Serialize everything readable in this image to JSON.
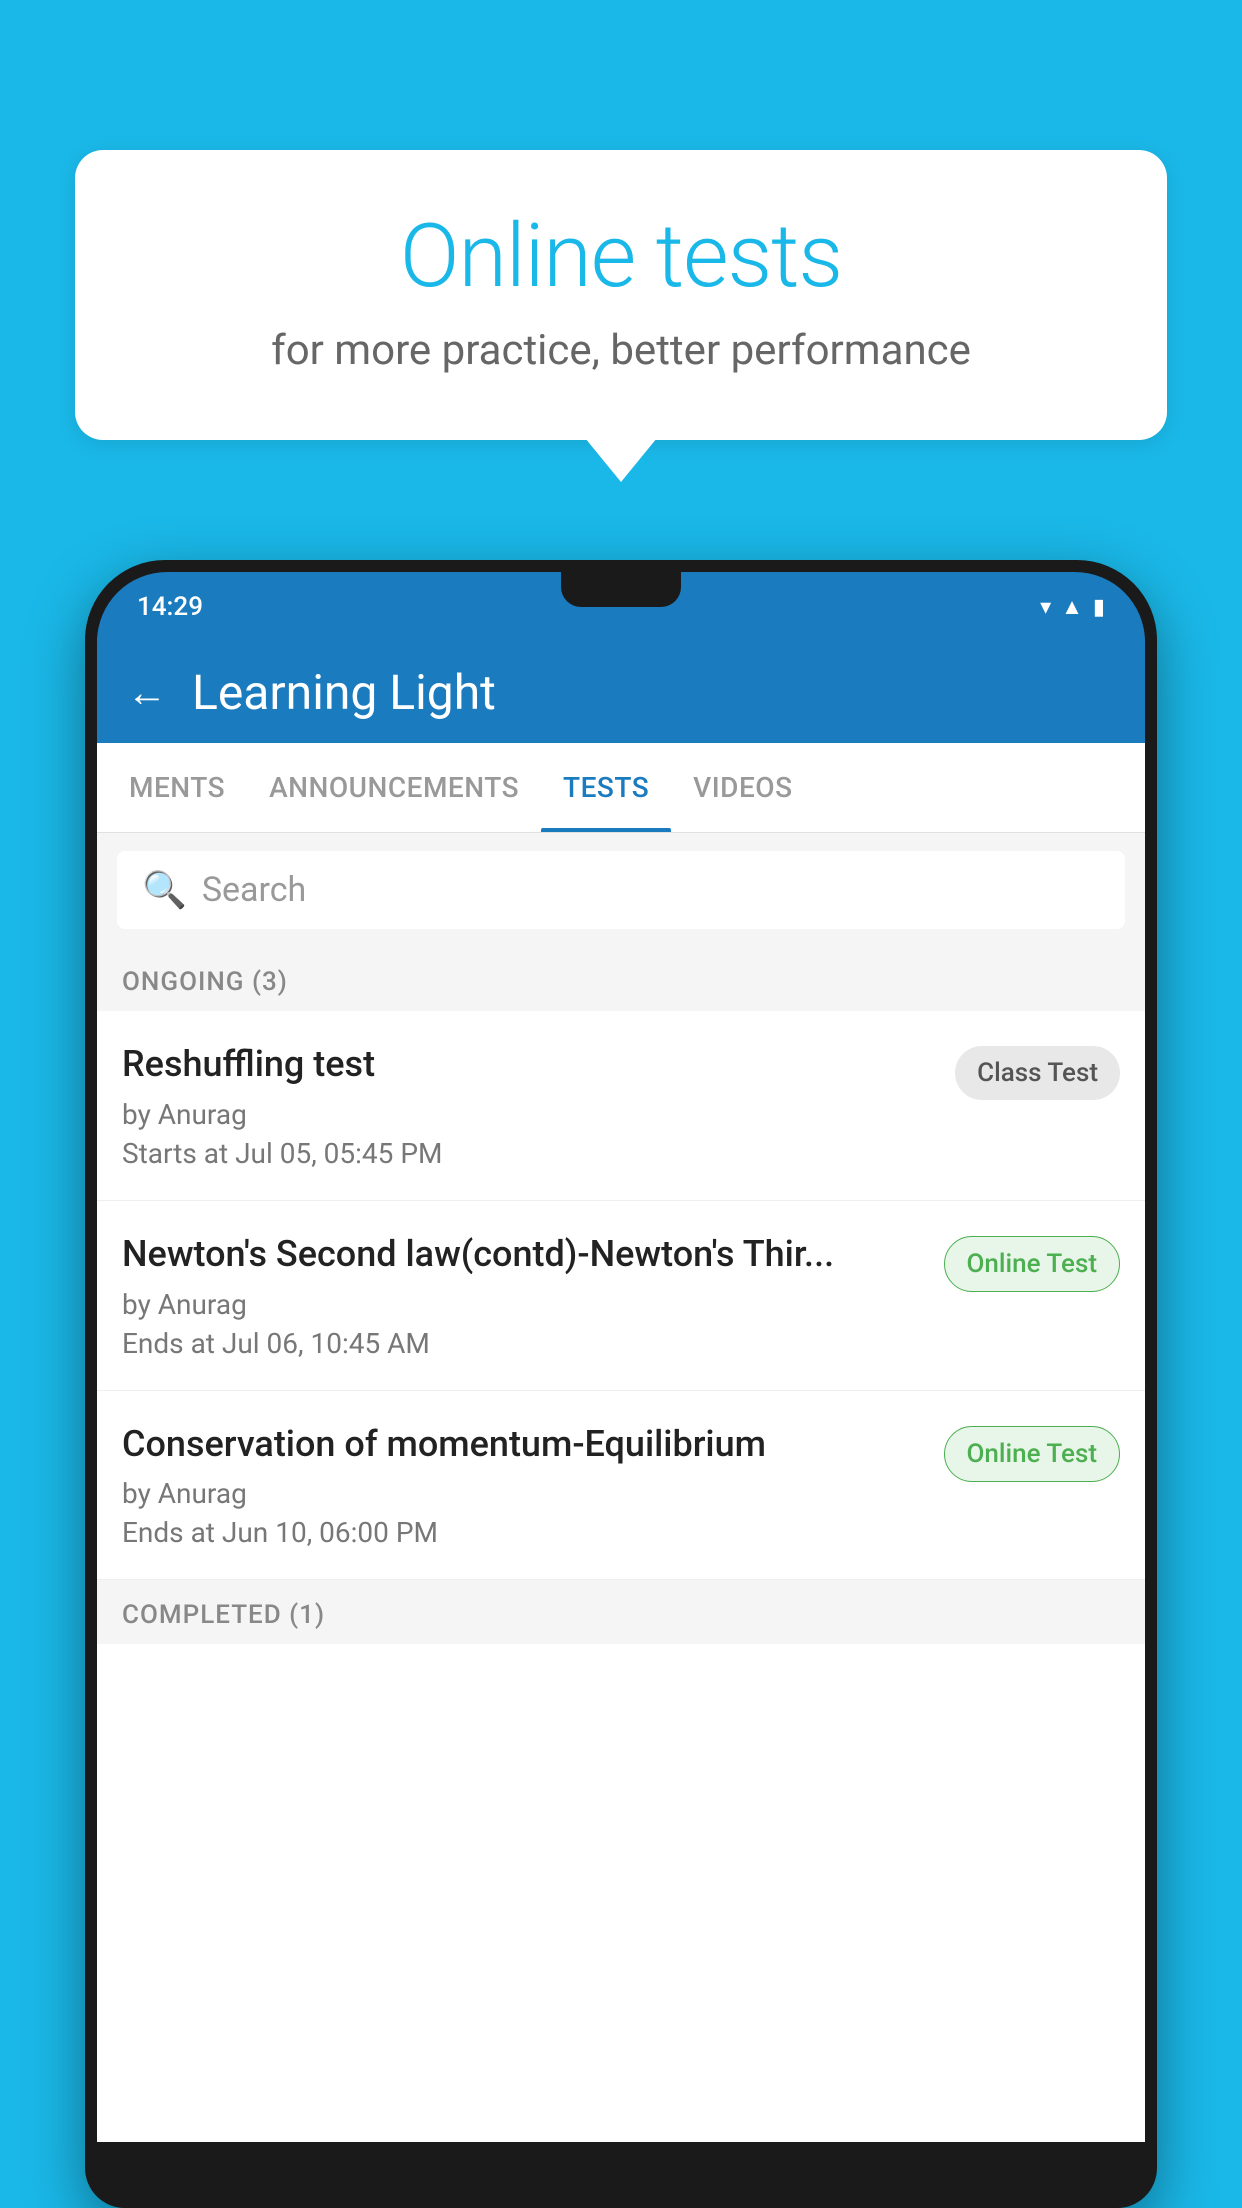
{
  "background_color": "#1ab8e8",
  "bubble": {
    "title": "Online tests",
    "subtitle": "for more practice, better performance"
  },
  "phone": {
    "status_bar": {
      "time": "14:29"
    },
    "header": {
      "title": "Learning Light",
      "back_label": "←"
    },
    "tabs": [
      {
        "label": "MENTS",
        "active": false
      },
      {
        "label": "ANNOUNCEMENTS",
        "active": false
      },
      {
        "label": "TESTS",
        "active": true
      },
      {
        "label": "VIDEOS",
        "active": false
      }
    ],
    "search": {
      "placeholder": "Search"
    },
    "ongoing_section": {
      "title": "ONGOING (3)"
    },
    "tests": [
      {
        "name": "Reshuffling test",
        "by": "by Anurag",
        "time_label": "Starts at",
        "time": "Jul 05, 05:45 PM",
        "badge": "Class Test",
        "badge_type": "class"
      },
      {
        "name": "Newton's Second law(contd)-Newton's Thir...",
        "by": "by Anurag",
        "time_label": "Ends at",
        "time": "Jul 06, 10:45 AM",
        "badge": "Online Test",
        "badge_type": "online"
      },
      {
        "name": "Conservation of momentum-Equilibrium",
        "by": "by Anurag",
        "time_label": "Ends at",
        "time": "Jun 10, 06:00 PM",
        "badge": "Online Test",
        "badge_type": "online"
      }
    ],
    "completed_section": {
      "title": "COMPLETED (1)"
    }
  }
}
